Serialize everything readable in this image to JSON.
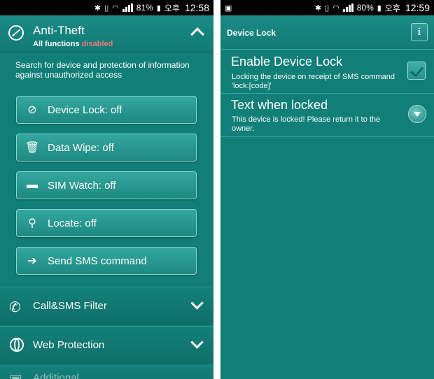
{
  "left": {
    "status": {
      "battery": "81%",
      "ampm": "오후",
      "time": "12:58"
    },
    "header": {
      "title": "Anti-Theft",
      "subtitle_prefix": "All functions",
      "subtitle_state": "disabled"
    },
    "description": "Search for device and protection of information against unauthorized access",
    "buttons": [
      {
        "label": "Device Lock: off",
        "icon": "block-icon"
      },
      {
        "label": "Data Wipe: off",
        "icon": "trash-icon"
      },
      {
        "label": "SIM Watch: off",
        "icon": "sim-card-icon"
      },
      {
        "label": "Locate: off",
        "icon": "satellite-icon"
      },
      {
        "label": "Send SMS command",
        "icon": "arrow-right-icon"
      }
    ],
    "sections": [
      {
        "label": "Call&SMS Filter",
        "icon": "phone-icon"
      },
      {
        "label": "Web Protection",
        "icon": "globe-icon"
      },
      {
        "label": "Additional",
        "icon": "briefcase-icon"
      }
    ]
  },
  "right": {
    "status": {
      "battery": "80%",
      "ampm": "오후",
      "time": "12:59"
    },
    "header": {
      "title": "Device Lock",
      "info_label": "i"
    },
    "settings": [
      {
        "title": "Enable Device Lock",
        "description": "Locking the device on receipt of SMS command 'lock:[code]'",
        "checked": true
      },
      {
        "title": "Text when locked",
        "description": "This device is locked! Please return it to the owner."
      }
    ]
  },
  "colors": {
    "background": "#117f78",
    "disabled": "#f47a7a",
    "statusbar": "#000000"
  }
}
